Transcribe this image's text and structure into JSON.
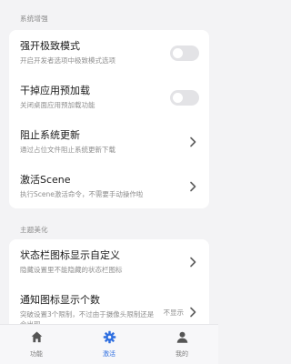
{
  "sections": {
    "system": {
      "header": "系统增强",
      "items": [
        {
          "title": "强开极致模式",
          "subtitle": "开启开发者选项中极致模式选项"
        },
        {
          "title": "干掉应用预加载",
          "subtitle": "关闭桌面应用预加载功能"
        },
        {
          "title": "阻止系统更新",
          "subtitle": "通过占位文件阻止系统更新下载"
        },
        {
          "title": "激活Scene",
          "subtitle": "执行Scene激活命令，不需要手动操作啦"
        }
      ]
    },
    "theme": {
      "header": "主题美化",
      "items": [
        {
          "title": "状态栏图标显示自定义",
          "subtitle": "隐藏设置里不能隐藏的状态栏图标"
        },
        {
          "title": "通知图标显示个数",
          "subtitle": "突破设置3个限制，不过由于摄像头限制还是会出现",
          "value": "不显示"
        }
      ]
    }
  },
  "toggles": {
    "extreme_mode": false,
    "app_preload": false
  },
  "tabbar": {
    "tabs": [
      {
        "label": "功能",
        "icon": "home-icon"
      },
      {
        "label": "激活",
        "icon": "gear-icon",
        "active": true
      },
      {
        "label": "我的",
        "icon": "person-icon"
      }
    ]
  },
  "colors": {
    "background": "#f3f3f5",
    "card": "#ffffff",
    "accent": "#2f6fe0",
    "toggle_off": "#e3e3e6",
    "secondary_text": "#8e8e8e"
  }
}
